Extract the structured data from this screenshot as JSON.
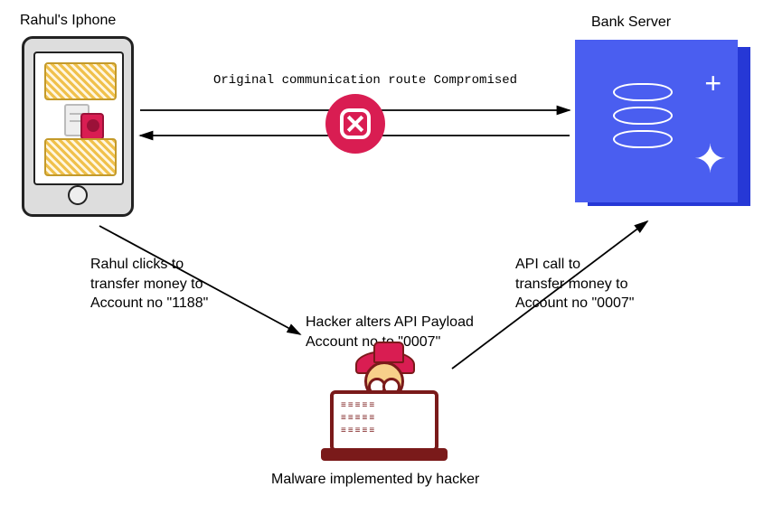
{
  "phone": {
    "title": "Rahul's Iphone"
  },
  "server": {
    "title": "Bank Server"
  },
  "compromised_label": "Original communication route Compromised",
  "step_rahul": "Rahul clicks to\ntransfer money to\nAccount no \"1188\"",
  "step_hacker": "Hacker alters API Payload\nAccount no to \"0007\"",
  "step_api": "API call to\ntransfer money to\nAccount no \"0007\"",
  "hacker_caption": "Malware implemented by hacker"
}
